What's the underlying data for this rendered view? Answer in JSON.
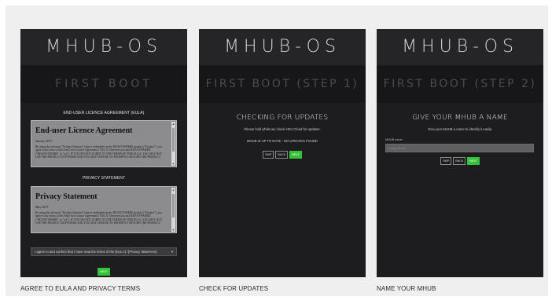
{
  "logo": "MHUB-OS",
  "screens": [
    {
      "band": "FIRST BOOT",
      "eula_label": "END-USER LICENCE AGREEMENT (EULA)",
      "eula_doc": {
        "heading": "End-user Licence Agreement",
        "date": "January 2017",
        "body": "By using the software (\"Product Software\") that is embedded on the HDANYWHERE product (\"Product\"), you agree to the terms of this End User Licence Agreement (\"EULA\") between you and HDANYWHERE (\"HDANYWHERE\" or \"we\"). IF YOU DO NOT AGREE TO THE TERMS OF THIS EULA, YOU MAY NOT USE THE PRODUCT SOFTWARE AND YOU MAY CHOOSE TO PROMPTLY RETURN THE PRODUCT"
      },
      "privacy_label": "PRIVACY STATEMENT",
      "privacy_doc": {
        "heading": "Privacy Statement",
        "date": "May 2017",
        "body": "By using the software (\"Product Software\") that is embedded on the HDANYWHERE product (\"Product\"), you agree to the terms of this End User Licence Agreement (\"EULA\") between you and HDANYWHERE (\"HDANYWHERE\" or \"we\"). IF YOU DO NOT AGREE TO THE TERMS OF THIS EULA, YOU MAY NOT USE THE PRODUCT SOFTWARE AND YOU MAY CHOOSE TO PROMPTLY RETURN THE PRODUCT"
      },
      "agree_select": "I agree to and confirm that I have read the terms of the [EULA] / [Privacy Statement]",
      "next_button": "NEXT",
      "caption": "AGREE TO EULA AND PRIVACY TERMS"
    },
    {
      "band": "FIRST BOOT (STEP 1)",
      "title": "CHECKING FOR UPDATES",
      "subtitle": "Please hold whilst we check HDA Cloud for updates.",
      "status": "MHUB IS UP TO DATE - NO UPDATES FOUND",
      "buttons": {
        "skip": "SKIP",
        "back": "BACK",
        "next": "NEXT"
      },
      "caption": "CHECK FOR UPDATES"
    },
    {
      "band": "FIRST BOOT (STEP 2)",
      "title": "GIVE YOUR MHUB A NAME",
      "subtitle": "Give your MHUB a name to identify it easily.",
      "field_label": "MHUB name",
      "field_placeholder": "Living Room",
      "buttons": {
        "skip": "SKIP",
        "back": "BACK",
        "next": "NEXT"
      },
      "caption": "NAME YOUR MHUB"
    }
  ],
  "colors": {
    "accent_green": "#35c23b",
    "screen_bg": "#1d1c1e",
    "band_bg": "#171618"
  }
}
